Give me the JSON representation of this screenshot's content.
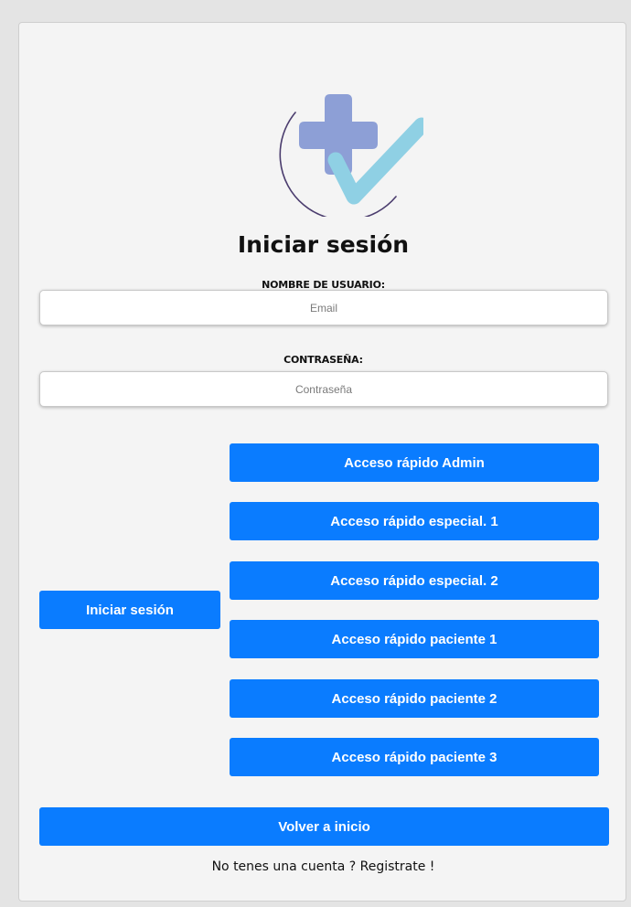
{
  "login": {
    "title": "Iniciar sesión",
    "username_label": "NOMBRE DE USUARIO:",
    "username_placeholder": "Email",
    "password_label": "CONTRASEÑA:",
    "password_placeholder": "Contraseña",
    "submit_label": "Iniciar sesión",
    "back_label": "Volver a inicio",
    "signup_text": "No tenes una cuenta ? Registrate !"
  },
  "quick_access": [
    {
      "label": "Acceso rápido Admin"
    },
    {
      "label": "Acceso rápido especial. 1"
    },
    {
      "label": "Acceso rápido especial. 2"
    },
    {
      "label": "Acceso rápido paciente 1"
    },
    {
      "label": "Acceso rápido paciente 2"
    },
    {
      "label": "Acceso rápido paciente 3"
    }
  ],
  "colors": {
    "primary_button": "#0a7cff",
    "logo_cross": "#8d9fd6",
    "logo_check": "#8fd0e4",
    "logo_ring": "#4b3d6e",
    "card_background": "#f4f4f4",
    "page_background": "#e4e4e4"
  },
  "icons": {
    "logo": "medical-cross-check-icon"
  }
}
